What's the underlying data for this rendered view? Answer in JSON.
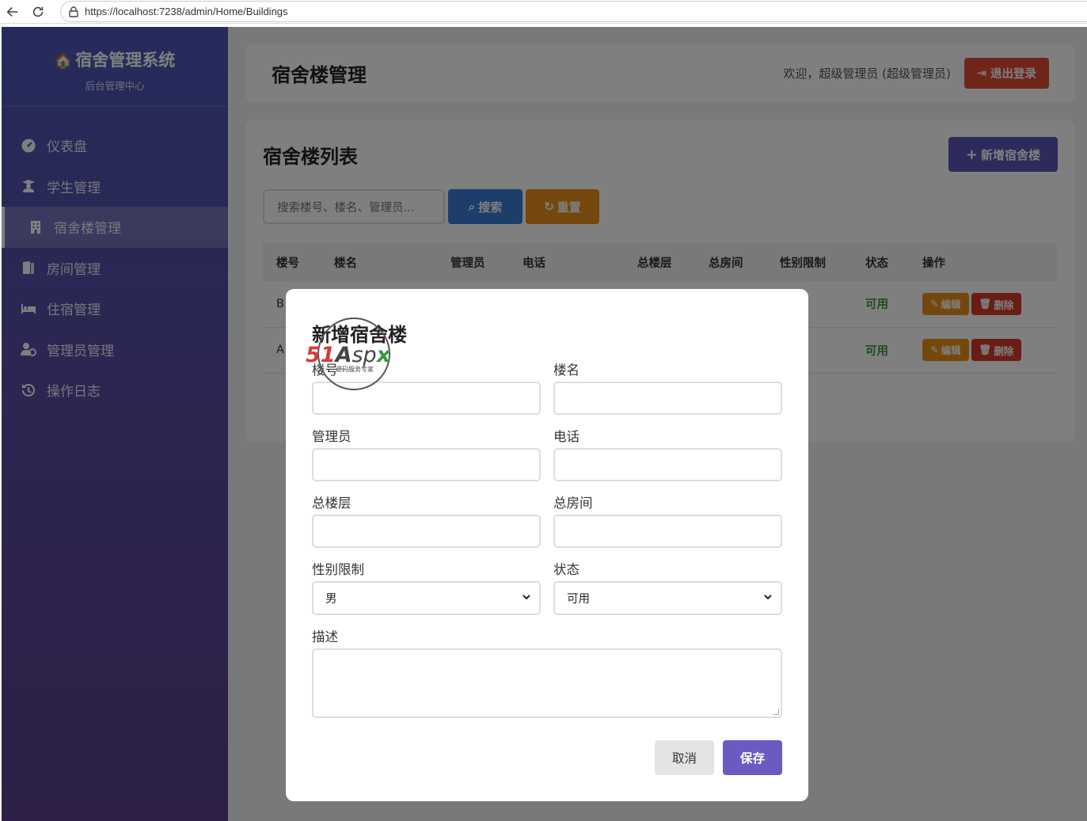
{
  "browser": {
    "url": "https://localhost:7238/admin/Home/Buildings"
  },
  "sidebar": {
    "brand_title": "宿舍管理系统",
    "brand_sub": "后台管理中心",
    "items": [
      {
        "label": "仪表盘",
        "icon": "dashboard-icon"
      },
      {
        "label": "学生管理",
        "icon": "student-icon"
      },
      {
        "label": "宿舍楼管理",
        "icon": "building-icon",
        "active": true
      },
      {
        "label": "房间管理",
        "icon": "door-icon"
      },
      {
        "label": "住宿管理",
        "icon": "bed-icon"
      },
      {
        "label": "管理员管理",
        "icon": "user-gear-icon"
      },
      {
        "label": "操作日志",
        "icon": "history-icon"
      }
    ]
  },
  "header": {
    "title": "宿舍楼管理",
    "welcome": "欢迎，超级管理员 (超级管理员)",
    "logout_label": "退出登录"
  },
  "list": {
    "title": "宿舍楼列表",
    "add_label": "新增宿舍楼",
    "search_placeholder": "搜索楼号、楼名、管理员...",
    "search_label": "搜索",
    "reset_label": "重置",
    "columns": [
      "楼号",
      "楼名",
      "管理员",
      "电话",
      "总楼层",
      "总房间",
      "性别限制",
      "状态",
      "操作"
    ],
    "rows": [
      {
        "code": "B",
        "status": "可用",
        "edit": "编辑",
        "delete": "删除"
      },
      {
        "code": "A",
        "status": "可用",
        "edit": "编辑",
        "delete": "删除"
      }
    ]
  },
  "modal": {
    "title": "新增宿舍楼",
    "fields": {
      "code": "楼号",
      "name": "楼名",
      "manager": "管理员",
      "phone": "电话",
      "floors": "总楼层",
      "rooms": "总房间",
      "gender": "性别限制",
      "gender_value": "男",
      "status": "状态",
      "status_value": "可用",
      "desc": "描述"
    },
    "cancel_label": "取消",
    "save_label": "保存"
  },
  "watermark": {
    "brand": "51Aspx",
    "tagline": "源码服务专家"
  },
  "colors": {
    "sidebar_top": "#4b57b8",
    "sidebar_bottom": "#5b3f8e",
    "primary": "#5a54b8",
    "search": "#3a7bd5",
    "warning": "#e8901a",
    "danger": "#e14a34",
    "success": "#3a9a3a"
  }
}
